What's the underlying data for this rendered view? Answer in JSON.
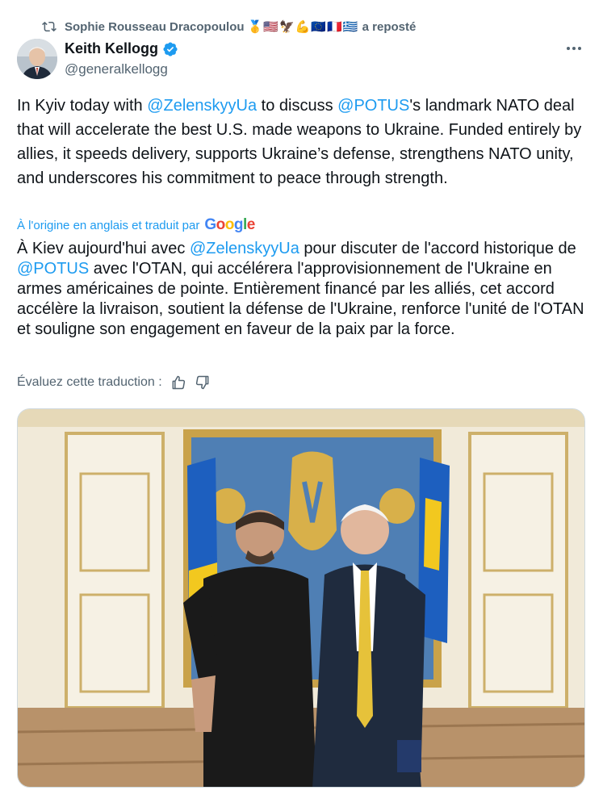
{
  "repost": {
    "name": "Sophie Rousseau Dracopoulou",
    "emojis": "🥇🇺🇸🦅💪🇪🇺🇫🇷🇬🇷",
    "label": "a reposté"
  },
  "author": {
    "display_name": "Keith Kellogg",
    "handle": "@generalkellogg"
  },
  "tweet": {
    "p1": "In Kyiv today with ",
    "m1": "@ZelenskyyUa",
    "p2": " to discuss ",
    "m2": "@POTUS",
    "p3": "'s landmark NATO deal that will accelerate the best U.S. made weapons to Ukraine. Funded entirely by allies, it speeds delivery, supports Ukraine’s defense, strengthens NATO unity, and underscores his commitment to peace through strength."
  },
  "translation": {
    "source_label": "À l'origine en anglais et traduit par",
    "google": [
      "G",
      "o",
      "o",
      "g",
      "l",
      "e"
    ],
    "p1": "À Kiev aujourd'hui avec ",
    "m1": "@ZelenskyyUa",
    "p2": " pour discuter de l'accord historique de ",
    "m2": "@POTUS",
    "p3": " avec l'OTAN, qui accélérera l'approvisionnement de l'Ukraine en armes américaines de pointe. Entièrement financé par les alliés, cet accord accélère la livraison, soutient la défense de l'Ukraine, renforce l'unité de l'OTAN et souligne son engagement en faveur de la paix par la force.",
    "rate_label": "Évaluez cette traduction :"
  },
  "colors": {
    "link": "#1d9bf0",
    "secondary_text": "#536471",
    "verified": "#1d9bf0"
  },
  "icons": {
    "repost": "repost-icon",
    "verified": "verified-badge-icon",
    "more": "more-dots-icon",
    "thumbs_up": "thumbs-up-icon",
    "thumbs_down": "thumbs-down-icon"
  }
}
